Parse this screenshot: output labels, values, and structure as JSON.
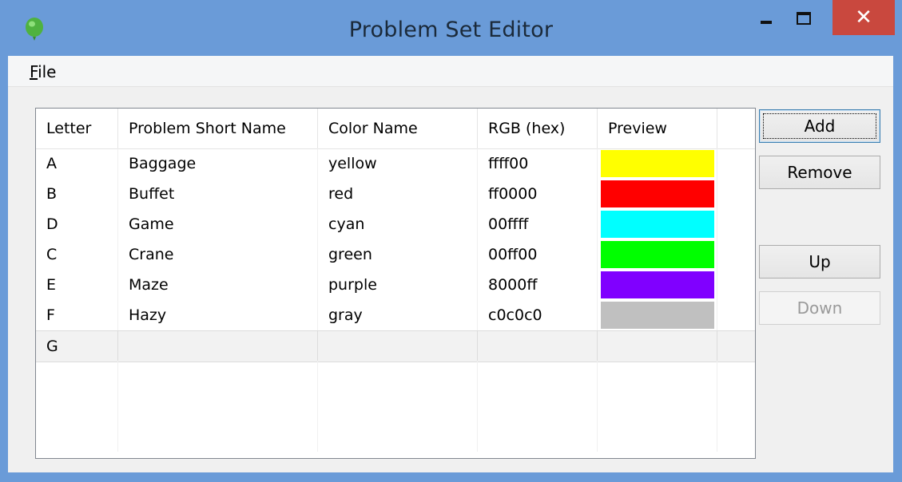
{
  "window": {
    "title": "Problem Set Editor"
  },
  "menu": {
    "file_prefix": "F",
    "file_rest": "ile"
  },
  "grid": {
    "columns": [
      "Letter",
      "Problem Short Name",
      "Color Name",
      "RGB (hex)",
      "Preview"
    ],
    "rows": [
      {
        "letter": "A",
        "name": "Baggage",
        "color": "yellow",
        "rgb": "ffff00",
        "preview": "#ffff00"
      },
      {
        "letter": "B",
        "name": "Buffet",
        "color": "red",
        "rgb": "ff0000",
        "preview": "#ff0000"
      },
      {
        "letter": "D",
        "name": "Game",
        "color": "cyan",
        "rgb": "00ffff",
        "preview": "#00ffff"
      },
      {
        "letter": "C",
        "name": "Crane",
        "color": "green",
        "rgb": "00ff00",
        "preview": "#00ff00"
      },
      {
        "letter": "E",
        "name": "Maze",
        "color": "purple",
        "rgb": "8000ff",
        "preview": "#8000ff"
      },
      {
        "letter": "F",
        "name": "Hazy",
        "color": "gray",
        "rgb": "c0c0c0",
        "preview": "#c0c0c0"
      }
    ],
    "new_row": {
      "letter": "G"
    }
  },
  "buttons": {
    "add": "Add",
    "remove": "Remove",
    "up": "Up",
    "down": "Down"
  },
  "colors": {
    "titlebar": "#6a9bd8",
    "close": "#c9483e",
    "app_icon": "#5cc24a"
  }
}
